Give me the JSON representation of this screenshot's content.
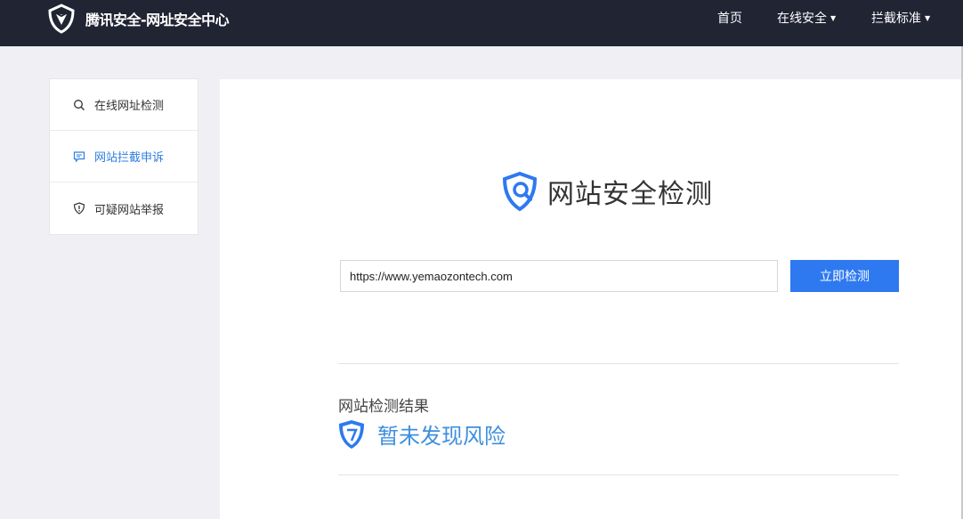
{
  "header": {
    "brand": "腾讯安全-网址安全中心",
    "logo_icon": "tencent-security-logo",
    "nav": [
      {
        "label": "首页",
        "has_dropdown": false
      },
      {
        "label": "在线安全",
        "has_dropdown": true
      },
      {
        "label": "拦截标准",
        "has_dropdown": true
      }
    ],
    "caret": "▼"
  },
  "sidebar": {
    "items": [
      {
        "label": "在线网址检测",
        "icon": "search-icon",
        "active": false
      },
      {
        "label": "网站拦截申诉",
        "icon": "message-icon",
        "active": true
      },
      {
        "label": "可疑网站举报",
        "icon": "shield-alert-icon",
        "active": false
      }
    ]
  },
  "main": {
    "title": "网站安全检测",
    "title_icon": "shield-search-icon",
    "url_value": "https://www.yemaozontech.com",
    "check_button": "立即检测",
    "result_label": "网站检测结果",
    "result_icon": "shield-check-icon",
    "result_text": "暂未发现风险"
  },
  "colors": {
    "topbar": "#202433",
    "accent": "#2e79f0",
    "active_text": "#2f7de1",
    "result_text": "#3d8fde"
  }
}
